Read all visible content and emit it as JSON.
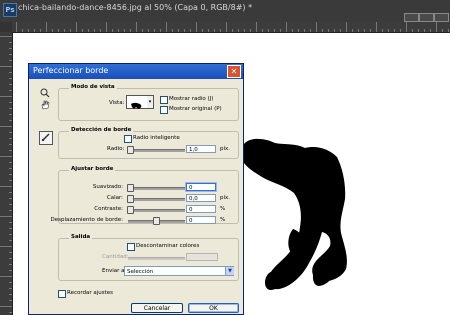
{
  "window": {
    "app_badge": "Ps",
    "document_title": "chica-bailando-dance-8456.jpg al 50% (Capa 0, RGB/8#) *"
  },
  "dialog": {
    "title": "Perfeccionar borde",
    "close_glyph": "✕",
    "tools": [
      "zoom-icon",
      "hand-icon",
      "refine-radius-brush-icon"
    ],
    "view_mode": {
      "legend": "Modo de vista",
      "view_label": "Vista:",
      "show_radius_label": "Mostrar radio (J)",
      "show_original_label": "Mostrar original (P)",
      "show_radius_checked": false,
      "show_original_checked": false
    },
    "edge_detection": {
      "legend": "Detección de borde",
      "smart_radius_label": "Radio inteligente",
      "smart_radius_checked": false,
      "radius_label": "Radio:",
      "radius_value": "1,0",
      "radius_unit": "píx.",
      "radius_slider": 0.0
    },
    "adjust_edge": {
      "legend": "Ajustar borde",
      "rows": [
        {
          "label": "Suavizado:",
          "value": "0",
          "unit": "",
          "slider": 0.0
        },
        {
          "label": "Calar:",
          "value": "0,0",
          "unit": "píx.",
          "slider": 0.0
        },
        {
          "label": "Contraste:",
          "value": "0",
          "unit": "%",
          "slider": 0.0
        },
        {
          "label": "Desplazamiento de borde:",
          "value": "0",
          "unit": "%",
          "slider": 0.5
        }
      ]
    },
    "output": {
      "legend": "Salida",
      "decontaminate_label": "Descontaminar colores",
      "decontaminate_checked": false,
      "amount_label": "Cantidad:",
      "send_to_label": "Enviar a:",
      "send_to_value": "Selección"
    },
    "remember_label": "Recordar ajustes",
    "remember_checked": false,
    "cancel_label": "Cancelar",
    "ok_label": "OK"
  },
  "colors": {
    "accent": "#1a4fb8",
    "dialog_bg": "#ece9d8",
    "silhouette": "#000000"
  }
}
